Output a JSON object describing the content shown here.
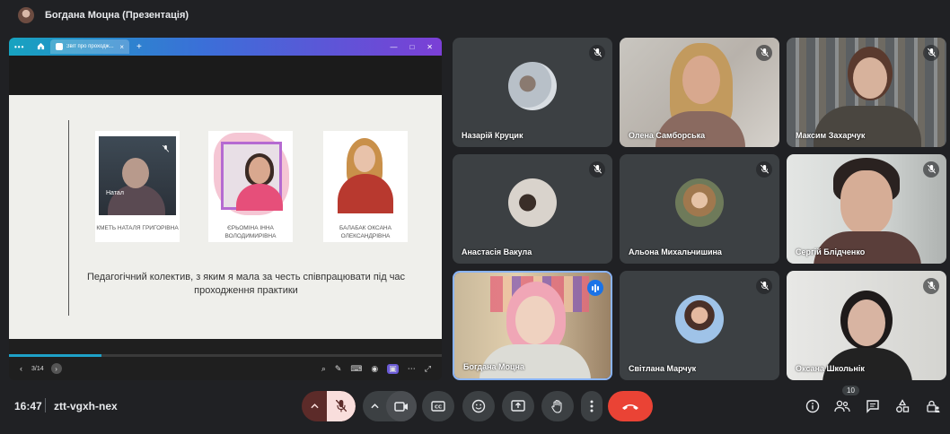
{
  "header": {
    "title": "Богдана Моцна (Презентація)"
  },
  "presentation": {
    "browser": {
      "tab_title": "Звіт про проходж...",
      "tab_close": "×",
      "new_tab": "+",
      "menu": "•••",
      "minimize": "—",
      "maximize": "□",
      "close": "✕"
    },
    "slide": {
      "people": [
        {
          "label": "КМЕТЬ НАТАЛЯ ГРИГОРІВНА",
          "video_tag": "Натал"
        },
        {
          "label": "ЄРЬОМІНА ІННА ВОЛОДИМИРІВНА"
        },
        {
          "label": "БАЛАБАК ОКСАНА ОЛЕКСАНДРІВНА"
        }
      ],
      "caption": "Педагогічний колектив, з яким я мала за честь співпрацювати під час проходження практики"
    },
    "controls": {
      "page": "3/14",
      "progress": 0.214
    }
  },
  "participants": [
    {
      "name": "Назарій Круцик",
      "muted": true
    },
    {
      "name": "Олена Самборська",
      "muted": true
    },
    {
      "name": "Максим Захарчук",
      "muted": true
    },
    {
      "name": "Анастасія Вакула",
      "muted": true
    },
    {
      "name": "Альона Михальчишина",
      "muted": true
    },
    {
      "name": "Сергій Блідченко",
      "muted": true
    },
    {
      "name": "Богдана Моцна",
      "muted": false,
      "speaking": true
    },
    {
      "name": "Світлана Марчук",
      "muted": true
    },
    {
      "name": "Оксана Школьнік",
      "muted": true
    }
  ],
  "meeting": {
    "time": "16:47",
    "code": "ztt-vgxh-nex",
    "participant_count": "10"
  },
  "colors": {
    "end_call": "#ea4335",
    "active_border": "#8ab4f8",
    "mic_off": "#f9dedc"
  }
}
